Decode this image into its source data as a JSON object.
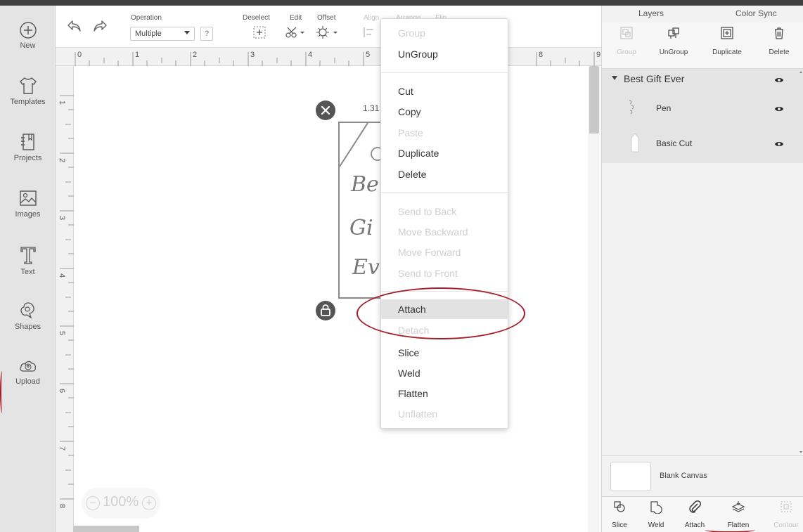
{
  "sidebar": {
    "items": [
      {
        "label": "New",
        "icon": "plus-circle-icon"
      },
      {
        "label": "Templates",
        "icon": "tshirt-icon"
      },
      {
        "label": "Projects",
        "icon": "projects-book-icon"
      },
      {
        "label": "Images",
        "icon": "image-icon"
      },
      {
        "label": "Text",
        "icon": "text-t-icon"
      },
      {
        "label": "Shapes",
        "icon": "shapes-icon"
      },
      {
        "label": "Upload",
        "icon": "upload-cloud-icon"
      }
    ]
  },
  "toolbar": {
    "operation_label": "Operation",
    "operation_value": "Multiple",
    "help_label": "?",
    "deselect_label": "Deselect",
    "edit_label": "Edit",
    "offset_label": "Offset",
    "align_label": "Align",
    "arrange_label": "Arrange",
    "flip_label": "Flip"
  },
  "ruler": {
    "h_marks": [
      "0",
      "1",
      "2",
      "3",
      "4",
      "5",
      "8",
      "9"
    ],
    "v_marks": [
      "1",
      "2",
      "3",
      "4",
      "5",
      "6",
      "7",
      "8"
    ]
  },
  "canvas": {
    "dimension_label": "1.31",
    "script_lines": [
      "Be",
      "Gi",
      "Ev"
    ],
    "zoom_value": "100%",
    "zoom_minus": "−",
    "zoom_plus": "+"
  },
  "context_menu": {
    "items": [
      {
        "label": "Group",
        "enabled": false
      },
      {
        "label": "UnGroup",
        "enabled": true
      },
      {
        "label": "Cut",
        "enabled": true
      },
      {
        "label": "Copy",
        "enabled": true
      },
      {
        "label": "Paste",
        "enabled": false
      },
      {
        "label": "Duplicate",
        "enabled": true
      },
      {
        "label": "Delete",
        "enabled": true
      },
      {
        "label": "Send to Back",
        "enabled": false
      },
      {
        "label": "Move Backward",
        "enabled": false
      },
      {
        "label": "Move Forward",
        "enabled": false
      },
      {
        "label": "Send to Front",
        "enabled": false
      },
      {
        "label": "Attach",
        "enabled": true,
        "highlighted": true
      },
      {
        "label": "Detach",
        "enabled": false
      },
      {
        "label": "Slice",
        "enabled": true
      },
      {
        "label": "Weld",
        "enabled": true
      },
      {
        "label": "Flatten",
        "enabled": true
      },
      {
        "label": "Unflatten",
        "enabled": false
      }
    ]
  },
  "right_panel": {
    "tabs": [
      "Layers",
      "Color Sync"
    ],
    "actions": [
      {
        "label": "Group",
        "enabled": false
      },
      {
        "label": "UnGroup",
        "enabled": true
      },
      {
        "label": "Duplicate",
        "enabled": true
      },
      {
        "label": "Delete",
        "enabled": true
      }
    ],
    "layer_group": "Best Gift Ever",
    "layers": [
      {
        "name": "Pen"
      },
      {
        "name": "Basic Cut"
      }
    ],
    "blank_canvas_label": "Blank Canvas",
    "bottom_actions": [
      {
        "label": "Slice",
        "enabled": true
      },
      {
        "label": "Weld",
        "enabled": true
      },
      {
        "label": "Attach",
        "enabled": true
      },
      {
        "label": "Flatten",
        "enabled": true
      },
      {
        "label": "Contour",
        "enabled": false
      }
    ]
  },
  "colors": {
    "annotation": "#a81c2a",
    "sidebar_bg": "#e4e4e4",
    "disabled_text": "#cfcfcf"
  }
}
